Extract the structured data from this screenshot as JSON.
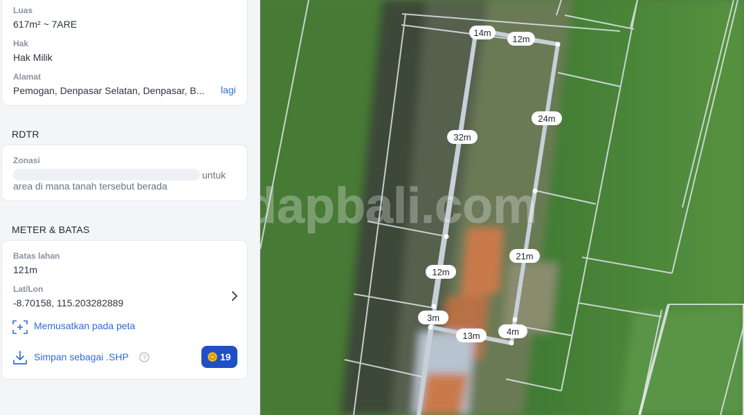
{
  "info": {
    "luas_label": "Luas",
    "luas_value": "617m² ~ 7ARE",
    "hak_label": "Hak",
    "hak_value": "Hak Milik",
    "alamat_label": "Alamat",
    "alamat_value": "Pemogan, Denpasar Selatan, Denpasar, B...",
    "alamat_more": "lagi"
  },
  "rdtr": {
    "section_title": "RDTR",
    "zonasi_label": "Zonasi",
    "zonasi_suffix": "untuk",
    "zonasi_text": "area di mana tanah tersebut berada"
  },
  "meter": {
    "section_title": "METER & BATAS",
    "batas_label": "Batas lahan",
    "batas_value": "121m",
    "latlon_label": "Lat/Lon",
    "latlon_value": "-8.70158, 115.203282889",
    "center_map_label": "Memusatkan pada peta",
    "save_shp_label": "Simpan sebagai .SHP",
    "coin_count": "19"
  },
  "map": {
    "watermark": "dapbali.com",
    "measurements": {
      "top_left": "14m",
      "top": "12m",
      "right_upper": "24m",
      "left_upper": "32m",
      "right_lower": "21m",
      "left_lower": "12m",
      "bottom_left": "3m",
      "bottom": "13m",
      "bottom_right": "4m"
    }
  },
  "colors": {
    "accent": "#2f6bd8",
    "coin_button": "#1f4fc4",
    "coin": "#f2c230",
    "plot_line": "#cfd6de"
  }
}
